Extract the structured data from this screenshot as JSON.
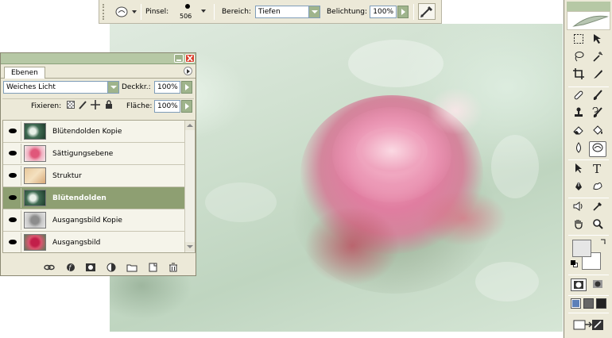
{
  "options_bar": {
    "brush_label": "Pinsel:",
    "brush_size": "506",
    "range_label": "Bereich:",
    "range_value": "Tiefen",
    "exposure_label": "Belichtung:",
    "exposure_value": "100%"
  },
  "layers_panel": {
    "tab_label": "Ebenen",
    "blend_mode": "Weiches Licht",
    "opacity_label": "Deckkr.:",
    "opacity_value": "100%",
    "lock_label": "Fixieren:",
    "fill_label": "Fläche:",
    "fill_value": "100%",
    "layers": [
      {
        "name": "Blütendolden Kopie",
        "selected": false,
        "thumb": "flowers-dark-icon"
      },
      {
        "name": "Sättigungsebene",
        "selected": false,
        "thumb": "rose-pink-icon"
      },
      {
        "name": "Struktur",
        "selected": false,
        "thumb": "texture-icon"
      },
      {
        "name": "Blütendolden",
        "selected": true,
        "thumb": "flowers-dark-icon"
      },
      {
        "name": "Ausgangsbild Kopie",
        "selected": false,
        "thumb": "rose-gray-icon"
      },
      {
        "name": "Ausgangsbild",
        "selected": false,
        "thumb": "rose-red-icon"
      }
    ],
    "footer_icons": [
      "link-icon",
      "layer-style-icon",
      "mask-icon",
      "adjustment-layer-icon",
      "new-group-icon",
      "new-layer-icon",
      "trash-icon"
    ]
  },
  "toolbox": {
    "tools": [
      "marquee-tool-icon",
      "move-tool-icon",
      "lasso-tool-icon",
      "magic-wand-tool-icon",
      "crop-tool-icon",
      "slice-tool-icon",
      "healing-brush-tool-icon",
      "brush-tool-icon",
      "clone-stamp-tool-icon",
      "history-brush-tool-icon",
      "eraser-tool-icon",
      "paint-bucket-tool-icon",
      "blur-tool-icon",
      "burn-tool-icon",
      "path-selection-tool-icon",
      "type-tool-icon",
      "pen-tool-icon",
      "custom-shape-tool-icon",
      "notes-tool-icon",
      "eyedropper-tool-icon",
      "hand-tool-icon",
      "zoom-tool-icon"
    ],
    "active_tool": "burn-tool-icon",
    "foreground_color": "#000000",
    "background_color": "#ffffff"
  },
  "colors": {
    "panel_bg": "#ece9d8",
    "selected_layer": "#8e9f72",
    "accent_green": "#9fb48c",
    "close_red": "#d9412e"
  }
}
